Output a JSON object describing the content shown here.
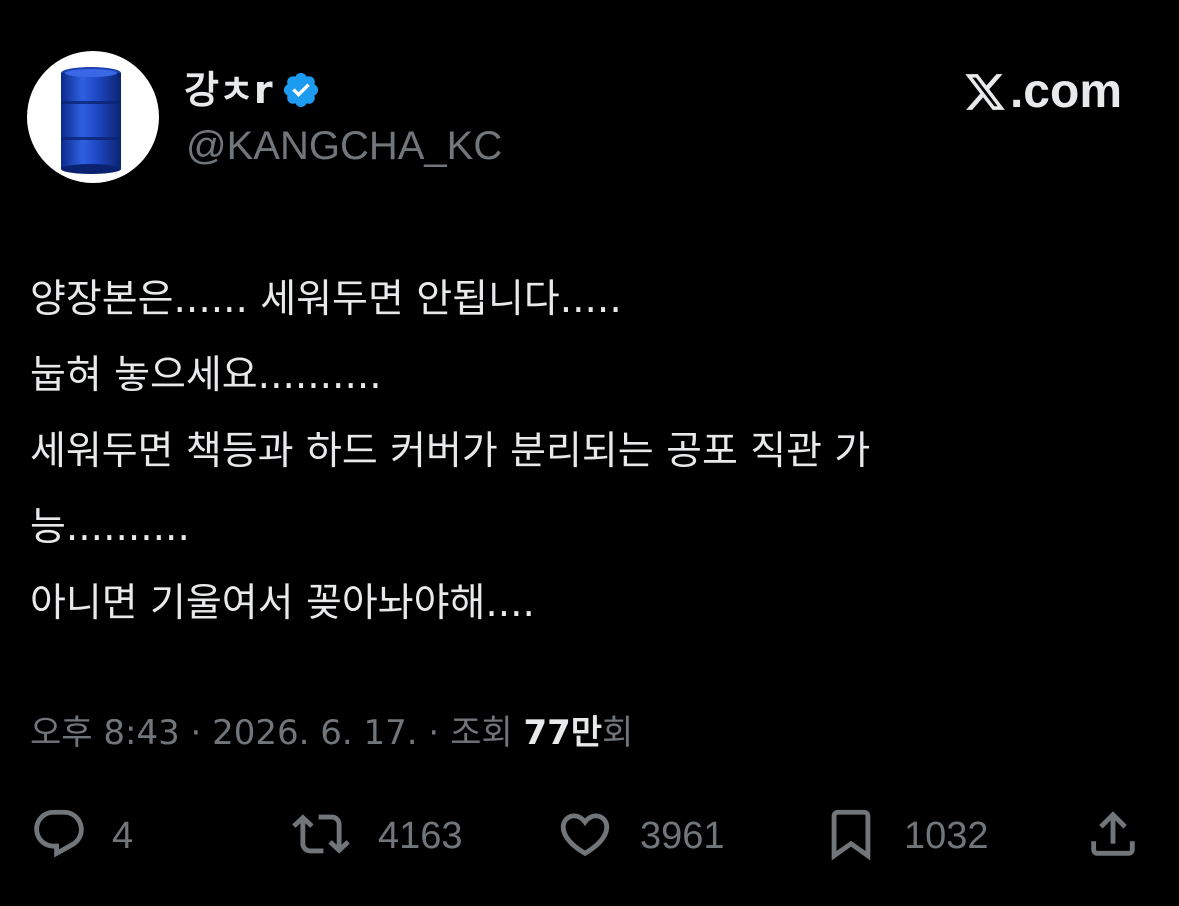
{
  "author": {
    "display_name": "강ㅊr",
    "handle": "@KANGCHA_KC",
    "verified": true,
    "avatar_icon": "blue-barrel-icon"
  },
  "brand": {
    "text": ".com",
    "icon": "x-logo-icon"
  },
  "tweet": {
    "lines": [
      "양장본은...... 세워두면 안됩니다.....",
      "눕혀 놓으세요..........",
      "세워두면 책등과 하드 커버가 분리되는 공포 직관 가",
      "능..........",
      "아니면 기울여서 꽂아놔야해...."
    ]
  },
  "meta": {
    "time": "오후 8:43",
    "separator": " · ",
    "date": "2026. 6. 17.",
    "views_label": "조회",
    "views_count": "77만",
    "views_suffix": "회"
  },
  "actions": {
    "replies": "4",
    "reposts": "4163",
    "likes": "3961",
    "bookmarks": "1032"
  },
  "colors": {
    "background": "#000000",
    "text_primary": "#e7e9ea",
    "text_secondary": "#71767b",
    "verified_blue": "#1d9bf0"
  }
}
